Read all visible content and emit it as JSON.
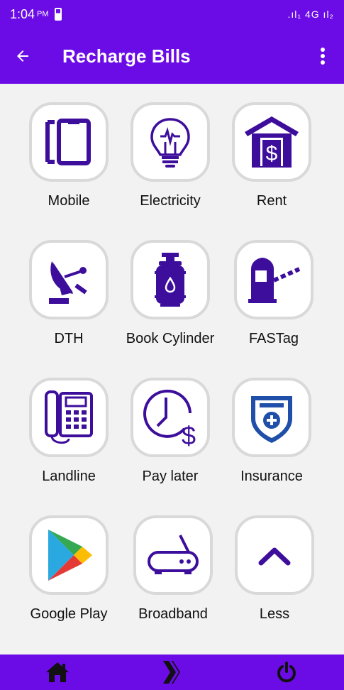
{
  "status": {
    "time": "1:04",
    "ampm": "PM",
    "signal": ".ıl₁ 4G ıl₂"
  },
  "appbar": {
    "title": "Recharge Bills"
  },
  "tiles": [
    {
      "label": "Mobile"
    },
    {
      "label": "Electricity"
    },
    {
      "label": "Rent"
    },
    {
      "label": "DTH"
    },
    {
      "label": "Book Cylinder"
    },
    {
      "label": "FASTag"
    },
    {
      "label": "Landline"
    },
    {
      "label": "Pay later"
    },
    {
      "label": "Insurance"
    },
    {
      "label": "Google Play"
    },
    {
      "label": "Broadband"
    },
    {
      "label": "Less"
    }
  ],
  "colors": {
    "accent": "#6b0be6",
    "icon": "#3d0e9c"
  },
  "icons": {
    "back": "arrow-left-icon",
    "menu": "kebab-menu-icon",
    "nav": [
      "home-icon",
      "brand-logo-icon",
      "power-icon"
    ]
  }
}
